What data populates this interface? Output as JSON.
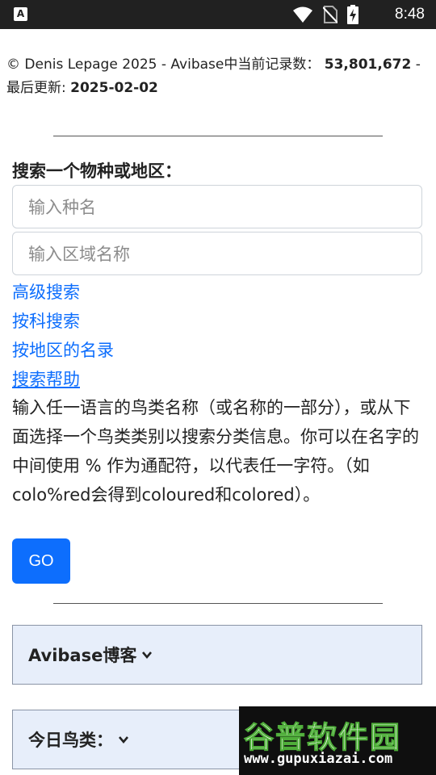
{
  "status_bar": {
    "time": "8:48"
  },
  "footer_info": {
    "copyright_text": "© Denis Lepage 2025 - Avibase中当前记录数：",
    "record_count": "53,801,672",
    "separator": " -",
    "updated_label": "最后更新: ",
    "updated_date": "2025-02-02"
  },
  "search": {
    "title": "搜索一个物种或地区：",
    "species_placeholder": "输入种名",
    "region_placeholder": "输入区域名称",
    "links": [
      "高级搜索",
      "按科搜索",
      "按地区的名录",
      "搜索帮助"
    ],
    "help_text": "输入任一语言的鸟类名称（或名称的一部分），或从下面选择一个鸟类类别以搜索分类信息。你可以在名字的中间使用 % 作为通配符，以代表任一字符。（如colo%red会得到coloured和colored）。",
    "go_label": "GO"
  },
  "panels": {
    "blog": "Avibase博客",
    "bird_of_day": "今日鸟类："
  },
  "watermark": {
    "title": "谷普软件园",
    "url": "www.gupuxiazai.com"
  },
  "colors": {
    "link": "#0d6efd",
    "button": "#0d6efd",
    "panel_bg": "#e7eefa",
    "status_bar": "#212121"
  }
}
